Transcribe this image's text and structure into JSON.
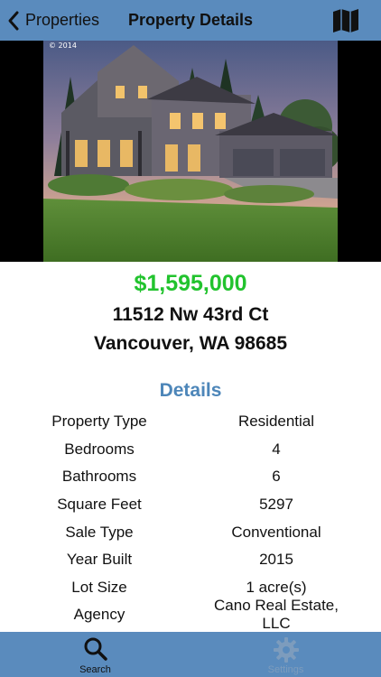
{
  "nav": {
    "back_label": "Properties",
    "title": "Property Details",
    "map_icon": "map-icon"
  },
  "hero": {
    "copyright": "© 2014"
  },
  "listing": {
    "price": "$1,595,000",
    "address_line1": "11512 Nw 43rd Ct",
    "address_line2": "Vancouver, WA 98685"
  },
  "details": {
    "heading": "Details",
    "rows": [
      {
        "label": "Property Type",
        "value": "Residential"
      },
      {
        "label": "Bedrooms",
        "value": "4"
      },
      {
        "label": "Bathrooms",
        "value": "6"
      },
      {
        "label": "Square Feet",
        "value": "5297"
      },
      {
        "label": "Sale Type",
        "value": "Conventional"
      },
      {
        "label": "Year Built",
        "value": "2015"
      },
      {
        "label": "Lot Size",
        "value": "1 acre(s)"
      },
      {
        "label": "Agency",
        "value": "Cano Real Estate, LLC"
      }
    ]
  },
  "tabbar": {
    "tabs": [
      {
        "label": "Search",
        "icon": "search-icon",
        "active": true
      },
      {
        "label": "Settings",
        "icon": "gear-icon",
        "active": false
      }
    ]
  },
  "colors": {
    "bar": "#5a8bbd",
    "price": "#22c32e",
    "heading": "#4d86b9"
  }
}
